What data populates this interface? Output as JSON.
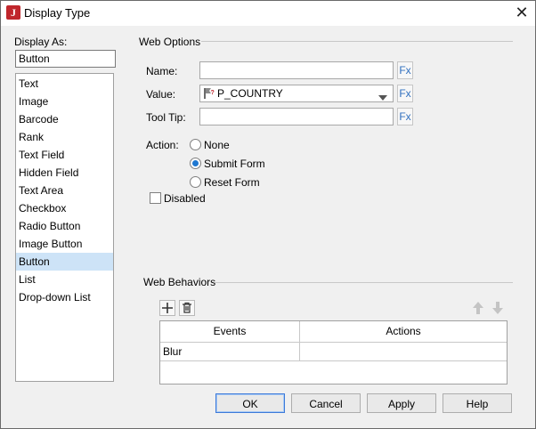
{
  "window": {
    "title": "Display Type",
    "icon": "jreport-logo-icon"
  },
  "display_as": {
    "label": "Display As:",
    "value": "Button",
    "items": [
      "Text",
      "Image",
      "Barcode",
      "Rank",
      "Text Field",
      "Hidden Field",
      "Text Area",
      "Checkbox",
      "Radio Button",
      "Image Button",
      "Button",
      "List",
      "Drop-down List"
    ],
    "selected": "Button"
  },
  "web_options": {
    "title": "Web Options",
    "name_label": "Name:",
    "name_value": "",
    "value_label": "Value:",
    "value_value": "P_COUNTRY",
    "tooltip_label": "Tool Tip:",
    "tooltip_value": "",
    "fx_label": "Fx",
    "action_label": "Action:",
    "actions": [
      "None",
      "Submit Form",
      "Reset Form"
    ],
    "selected_action": "Submit Form",
    "disabled_label": "Disabled",
    "disabled_checked": false
  },
  "web_behaviors": {
    "title": "Web Behaviors",
    "columns": [
      "Events",
      "Actions"
    ],
    "rows": [
      [
        "Blur",
        ""
      ]
    ]
  },
  "buttons": {
    "ok": "OK",
    "cancel": "Cancel",
    "apply": "Apply",
    "help": "Help"
  },
  "colors": {
    "selection": "#cde3f7",
    "accent": "#1f78d1",
    "brand": "#c0262c"
  }
}
